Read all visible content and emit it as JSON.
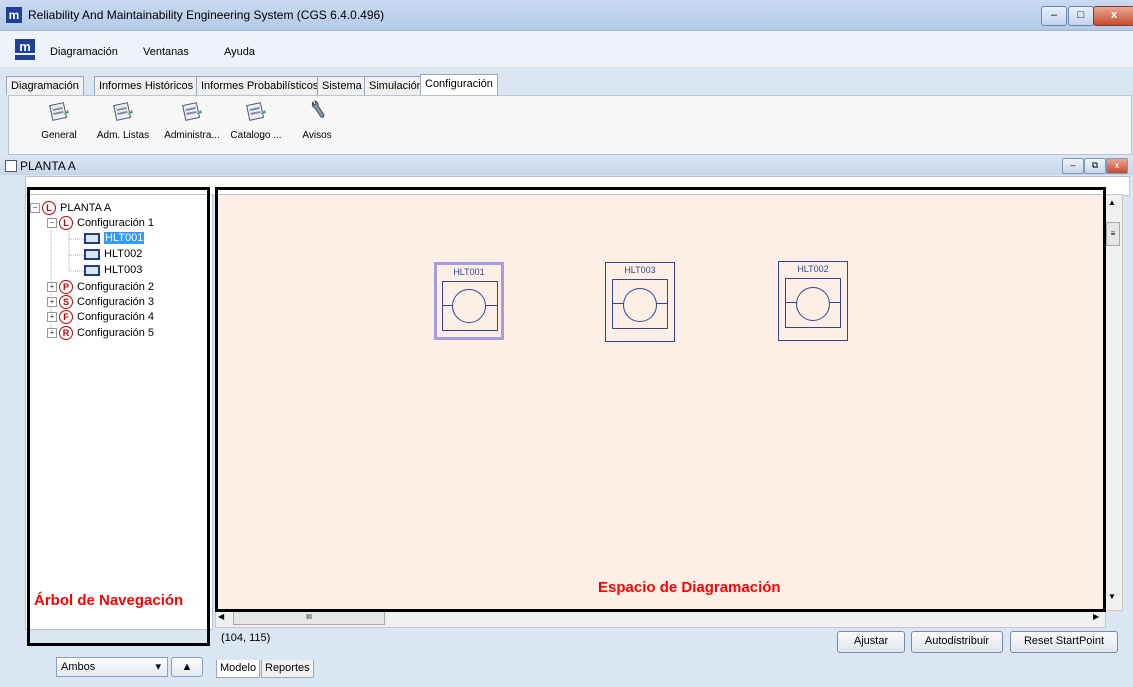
{
  "window": {
    "logo_letter": "m",
    "title": "Reliability And Maintainability Engineering System (CGS 6.4.0.496)",
    "controls": [
      "–",
      "□",
      "x"
    ]
  },
  "menu": {
    "logo_text": "m",
    "items": [
      "Diagramación",
      "Ventanas",
      "Ayuda"
    ]
  },
  "tabs": [
    {
      "label": "Diagramación",
      "active": false
    },
    {
      "label": "Informes Históricos",
      "active": false
    },
    {
      "label": "Informes Probabilísticos",
      "active": false
    },
    {
      "label": "Sistema",
      "active": false
    },
    {
      "label": "Simulación",
      "active": false
    },
    {
      "label": "Configuración",
      "active": true
    }
  ],
  "toolbar": {
    "items": [
      {
        "label": "General",
        "icon": "calendar-icon"
      },
      {
        "label": "Adm. Listas",
        "icon": "calendar-icon"
      },
      {
        "label": "Administra...",
        "icon": "calendar-icon"
      },
      {
        "label": "Catalogo ...",
        "icon": "calendar-icon"
      },
      {
        "label": "Avisos",
        "icon": "wrench-icon"
      }
    ]
  },
  "inner_window": {
    "title": "PLANTA A",
    "controls": [
      "–",
      "⧉",
      "x"
    ]
  },
  "tree": {
    "root": {
      "symbol": "L",
      "label": "PLANTA A"
    },
    "config1": {
      "symbol": "L",
      "label": "Configuración 1"
    },
    "components": [
      "HLT001",
      "HLT002",
      "HLT003"
    ],
    "selected": "HLT001",
    "configs": [
      {
        "symbol": "P",
        "label": "Configuración 2"
      },
      {
        "symbol": "S",
        "label": "Configuración 3"
      },
      {
        "symbol": "F",
        "label": "Configuración 4"
      },
      {
        "symbol": "R",
        "label": "Configuración 5"
      }
    ]
  },
  "diagram": {
    "blocks": [
      {
        "label": "HLT001",
        "selected": true
      },
      {
        "label": "HLT003",
        "selected": false
      },
      {
        "label": "HLT002",
        "selected": false
      }
    ],
    "hscroll_grip": "III",
    "vscroll_grip": "≡"
  },
  "annotations": {
    "tree_label": "Árbol de Navegación",
    "diagram_label": "Espacio de Diagramación",
    "color": "#ff0000"
  },
  "status": {
    "coordinates": "(104, 115)"
  },
  "buttons": {
    "ajustar": "Ajustar",
    "autodistribuir": "Autodistribuir",
    "reset": "Reset StartPoint"
  },
  "bottom": {
    "dropdown_value": "Ambos",
    "dropdown_arrow": "▾",
    "up_arrow": "▲",
    "tabs": [
      {
        "label": "Modelo",
        "active": true
      },
      {
        "label": "Reportes",
        "active": false
      }
    ]
  }
}
